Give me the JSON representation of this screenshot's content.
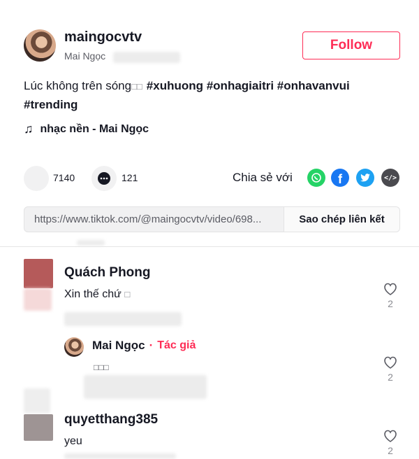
{
  "author": {
    "username": "maingocvtv",
    "display_name": "Mai Ngọc",
    "follow_label": "Follow"
  },
  "post": {
    "caption": "Lúc không trên sóng",
    "caption_emoji": "□□",
    "hashtags_line1": "#xuhuong #onhagiaitri #onhavanvui",
    "hashtags_line2": "#trending",
    "music": "nhạc nền - Mai Ngọc"
  },
  "stats": {
    "likes": "7140",
    "comments": "121"
  },
  "share": {
    "label": "Chia sẻ với",
    "icons": [
      "whatsapp-icon",
      "facebook-icon",
      "twitter-icon",
      "embed-icon"
    ],
    "colors": {
      "whatsapp": "#25d366",
      "facebook": "#1877f2",
      "twitter": "#1da1f2",
      "embed": "#4a4a4f"
    }
  },
  "link": {
    "url": "https://www.tiktok.com/@maingocvtv/video/698...",
    "copy_label": "Sao chép liên kết"
  },
  "comments": [
    {
      "username": "Quách Phong",
      "text": "Xin thế chứ",
      "text_emoji": "□",
      "likes": "2",
      "reply": {
        "username": "Mai Ngọc",
        "separator": "·",
        "badge": "Tác giả",
        "text": "□□□",
        "likes": "2"
      }
    },
    {
      "username": "quyetthang385",
      "text": "yeu",
      "likes": "2"
    }
  ],
  "accent_color": "#fe2c55"
}
